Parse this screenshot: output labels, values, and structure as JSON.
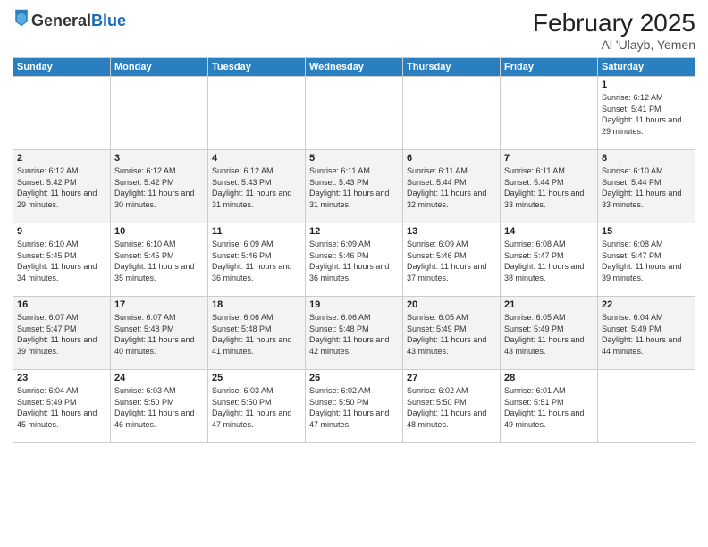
{
  "logo": {
    "general": "General",
    "blue": "Blue"
  },
  "title": "February 2025",
  "location": "Al 'Ulayb, Yemen",
  "days_of_week": [
    "Sunday",
    "Monday",
    "Tuesday",
    "Wednesday",
    "Thursday",
    "Friday",
    "Saturday"
  ],
  "weeks": [
    [
      {
        "day": "",
        "info": ""
      },
      {
        "day": "",
        "info": ""
      },
      {
        "day": "",
        "info": ""
      },
      {
        "day": "",
        "info": ""
      },
      {
        "day": "",
        "info": ""
      },
      {
        "day": "",
        "info": ""
      },
      {
        "day": "1",
        "info": "Sunrise: 6:12 AM\nSunset: 5:41 PM\nDaylight: 11 hours and 29 minutes."
      }
    ],
    [
      {
        "day": "2",
        "info": "Sunrise: 6:12 AM\nSunset: 5:42 PM\nDaylight: 11 hours and 29 minutes."
      },
      {
        "day": "3",
        "info": "Sunrise: 6:12 AM\nSunset: 5:42 PM\nDaylight: 11 hours and 30 minutes."
      },
      {
        "day": "4",
        "info": "Sunrise: 6:12 AM\nSunset: 5:43 PM\nDaylight: 11 hours and 31 minutes."
      },
      {
        "day": "5",
        "info": "Sunrise: 6:11 AM\nSunset: 5:43 PM\nDaylight: 11 hours and 31 minutes."
      },
      {
        "day": "6",
        "info": "Sunrise: 6:11 AM\nSunset: 5:44 PM\nDaylight: 11 hours and 32 minutes."
      },
      {
        "day": "7",
        "info": "Sunrise: 6:11 AM\nSunset: 5:44 PM\nDaylight: 11 hours and 33 minutes."
      },
      {
        "day": "8",
        "info": "Sunrise: 6:10 AM\nSunset: 5:44 PM\nDaylight: 11 hours and 33 minutes."
      }
    ],
    [
      {
        "day": "9",
        "info": "Sunrise: 6:10 AM\nSunset: 5:45 PM\nDaylight: 11 hours and 34 minutes."
      },
      {
        "day": "10",
        "info": "Sunrise: 6:10 AM\nSunset: 5:45 PM\nDaylight: 11 hours and 35 minutes."
      },
      {
        "day": "11",
        "info": "Sunrise: 6:09 AM\nSunset: 5:46 PM\nDaylight: 11 hours and 36 minutes."
      },
      {
        "day": "12",
        "info": "Sunrise: 6:09 AM\nSunset: 5:46 PM\nDaylight: 11 hours and 36 minutes."
      },
      {
        "day": "13",
        "info": "Sunrise: 6:09 AM\nSunset: 5:46 PM\nDaylight: 11 hours and 37 minutes."
      },
      {
        "day": "14",
        "info": "Sunrise: 6:08 AM\nSunset: 5:47 PM\nDaylight: 11 hours and 38 minutes."
      },
      {
        "day": "15",
        "info": "Sunrise: 6:08 AM\nSunset: 5:47 PM\nDaylight: 11 hours and 39 minutes."
      }
    ],
    [
      {
        "day": "16",
        "info": "Sunrise: 6:07 AM\nSunset: 5:47 PM\nDaylight: 11 hours and 39 minutes."
      },
      {
        "day": "17",
        "info": "Sunrise: 6:07 AM\nSunset: 5:48 PM\nDaylight: 11 hours and 40 minutes."
      },
      {
        "day": "18",
        "info": "Sunrise: 6:06 AM\nSunset: 5:48 PM\nDaylight: 11 hours and 41 minutes."
      },
      {
        "day": "19",
        "info": "Sunrise: 6:06 AM\nSunset: 5:48 PM\nDaylight: 11 hours and 42 minutes."
      },
      {
        "day": "20",
        "info": "Sunrise: 6:05 AM\nSunset: 5:49 PM\nDaylight: 11 hours and 43 minutes."
      },
      {
        "day": "21",
        "info": "Sunrise: 6:05 AM\nSunset: 5:49 PM\nDaylight: 11 hours and 43 minutes."
      },
      {
        "day": "22",
        "info": "Sunrise: 6:04 AM\nSunset: 5:49 PM\nDaylight: 11 hours and 44 minutes."
      }
    ],
    [
      {
        "day": "23",
        "info": "Sunrise: 6:04 AM\nSunset: 5:49 PM\nDaylight: 11 hours and 45 minutes."
      },
      {
        "day": "24",
        "info": "Sunrise: 6:03 AM\nSunset: 5:50 PM\nDaylight: 11 hours and 46 minutes."
      },
      {
        "day": "25",
        "info": "Sunrise: 6:03 AM\nSunset: 5:50 PM\nDaylight: 11 hours and 47 minutes."
      },
      {
        "day": "26",
        "info": "Sunrise: 6:02 AM\nSunset: 5:50 PM\nDaylight: 11 hours and 47 minutes."
      },
      {
        "day": "27",
        "info": "Sunrise: 6:02 AM\nSunset: 5:50 PM\nDaylight: 11 hours and 48 minutes."
      },
      {
        "day": "28",
        "info": "Sunrise: 6:01 AM\nSunset: 5:51 PM\nDaylight: 11 hours and 49 minutes."
      },
      {
        "day": "",
        "info": ""
      }
    ]
  ]
}
